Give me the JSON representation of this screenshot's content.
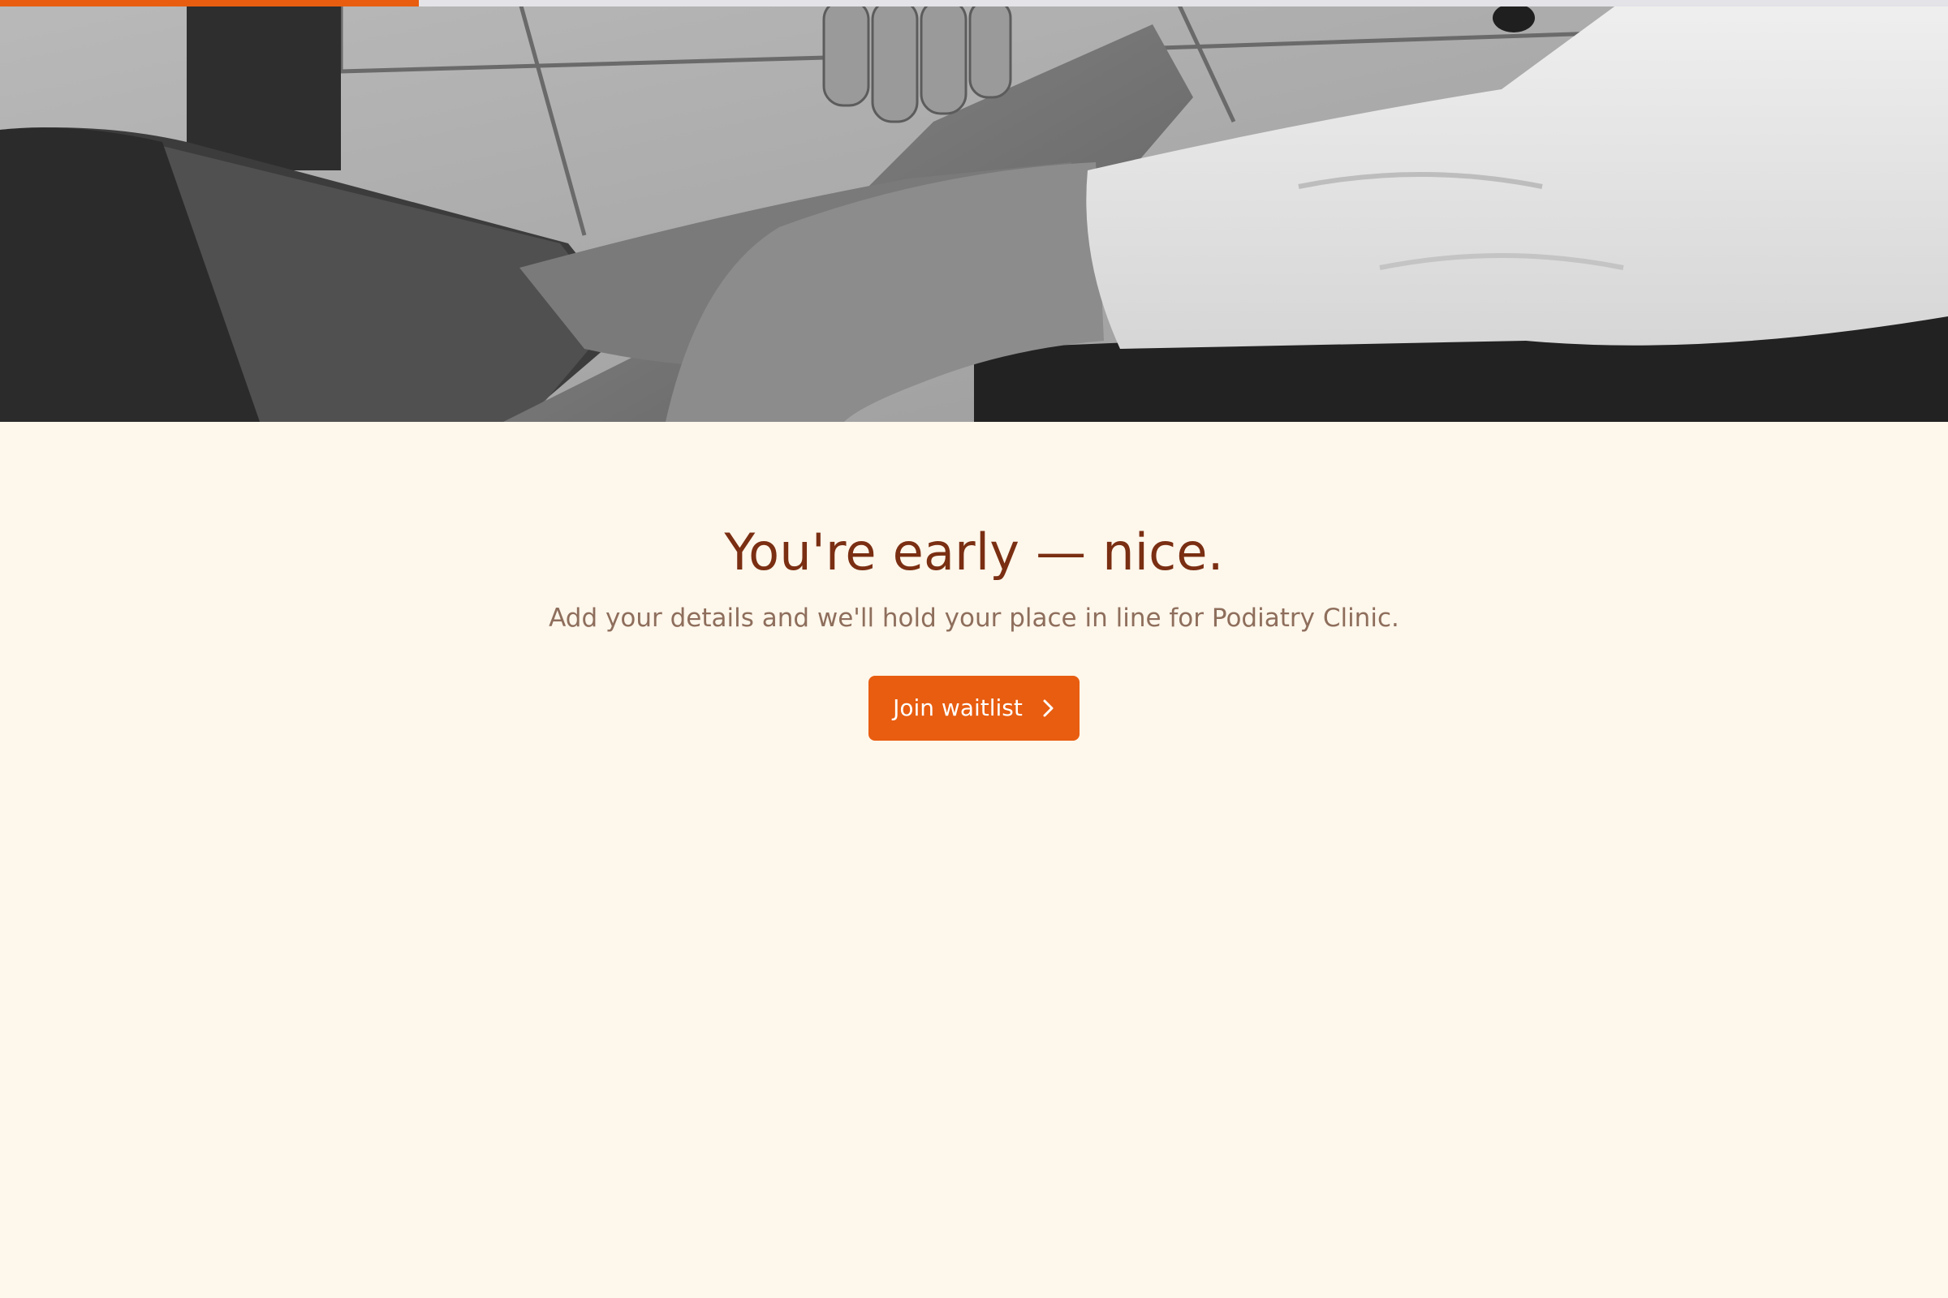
{
  "progress": {
    "value": 0.215,
    "color": "#E85D10",
    "track_color": "#E3E3E8"
  },
  "hero": {
    "image_subject": "podiatrist-examining-foot-photo"
  },
  "main": {
    "headline": "You're early — nice.",
    "subtitle": "Add your details and we'll hold your place in line for Podiatry Clinic.",
    "cta_label": "Join waitlist",
    "cta_icon": "chevron-right-icon"
  },
  "colors": {
    "background": "#FEF7EB",
    "accent": "#E85D10",
    "headline": "#7A2E12",
    "subtitle": "#8E6E5C"
  }
}
